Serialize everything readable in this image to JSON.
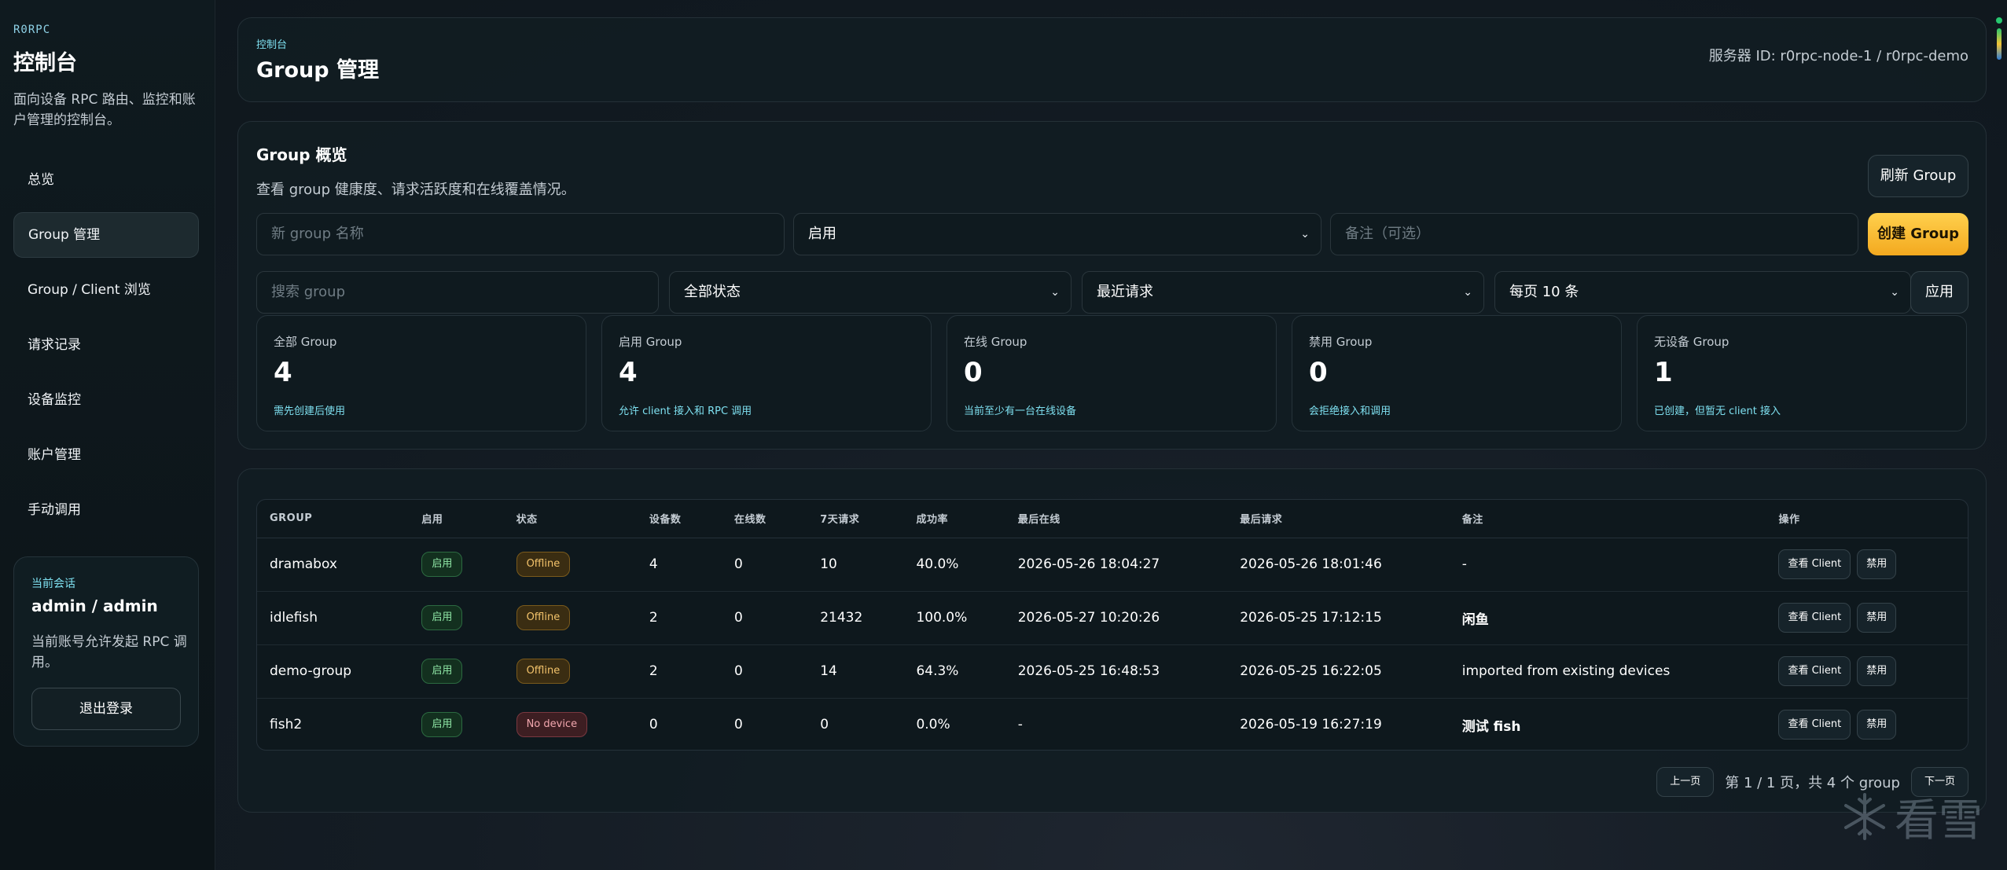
{
  "sidebar": {
    "brand": "R0RPC",
    "title": "控制台",
    "description": "面向设备 RPC 路由、监控和账户管理的控制台。",
    "nav": [
      {
        "label": "总览",
        "active": false
      },
      {
        "label": "Group 管理",
        "active": true
      },
      {
        "label": "Group / Client 浏览",
        "active": false
      },
      {
        "label": "请求记录",
        "active": false
      },
      {
        "label": "设备监控",
        "active": false
      },
      {
        "label": "账户管理",
        "active": false
      },
      {
        "label": "手动调用",
        "active": false
      }
    ],
    "session": {
      "label": "当前会话",
      "user": "admin / admin",
      "description": "当前账号允许发起 RPC 调用。",
      "logout_label": "退出登录"
    }
  },
  "header": {
    "breadcrumb": "控制台",
    "title": "Group 管理",
    "server": "服务器 ID: r0rpc-node-1 / r0rpc-demo"
  },
  "overview": {
    "title": "Group 概览",
    "description": "查看 group 健康度、请求活跃度和在线覆盖情况。",
    "refresh_label": "刷新 Group",
    "create_label": "创建 Group",
    "apply_label": "应用",
    "name_placeholder": "新 group 名称",
    "enable_select": "启用",
    "note_placeholder": "备注（可选）",
    "search_placeholder": "搜索 group",
    "status_select": "全部状态",
    "sort_select": "最近请求",
    "page_size_select": "每页 10 条",
    "stats": [
      {
        "label": "全部 Group",
        "value": "4",
        "note": "需先创建后使用"
      },
      {
        "label": "启用 Group",
        "value": "4",
        "note": "允许 client 接入和 RPC 调用"
      },
      {
        "label": "在线 Group",
        "value": "0",
        "note": "当前至少有一台在线设备"
      },
      {
        "label": "禁用 Group",
        "value": "0",
        "note": "会拒绝接入和调用"
      },
      {
        "label": "无设备 Group",
        "value": "1",
        "note": "已创建，但暂无 client 接入"
      }
    ]
  },
  "table": {
    "columns": [
      "GROUP",
      "启用",
      "状态",
      "设备数",
      "在线数",
      "7天请求",
      "成功率",
      "最后在线",
      "最后请求",
      "备注",
      "操作"
    ],
    "rows": [
      {
        "group": "dramabox",
        "enabled": "启用",
        "status": "Offline",
        "status_kind": "offline",
        "devices": "4",
        "online": "0",
        "requests": "10",
        "success": "40.0%",
        "last_online": "2026-05-26 18:04:27",
        "last_request": "2026-05-26 18:01:46",
        "note": "-",
        "note_bold": false
      },
      {
        "group": "idlefish",
        "enabled": "启用",
        "status": "Offline",
        "status_kind": "offline",
        "devices": "2",
        "online": "0",
        "requests": "21432",
        "success": "100.0%",
        "last_online": "2026-05-27 10:20:26",
        "last_request": "2026-05-25 17:12:15",
        "note": "闲鱼",
        "note_bold": true
      },
      {
        "group": "demo-group",
        "enabled": "启用",
        "status": "Offline",
        "status_kind": "offline",
        "devices": "2",
        "online": "0",
        "requests": "14",
        "success": "64.3%",
        "last_online": "2026-05-25 16:48:53",
        "last_request": "2026-05-25 16:22:05",
        "note": "imported from existing devices",
        "note_bold": false
      },
      {
        "group": "fish2",
        "enabled": "启用",
        "status": "No device",
        "status_kind": "nodevice",
        "devices": "0",
        "online": "0",
        "requests": "0",
        "success": "0.0%",
        "last_online": "-",
        "last_request": "2026-05-19 16:27:19",
        "note": "测试 fish",
        "note_bold": true
      }
    ],
    "view_label": "查看 Client",
    "disable_label": "禁用"
  },
  "pagination": {
    "prev_label": "上一页",
    "info": "第 1 / 1 页，共 4 个 group",
    "next_label": "下一页"
  },
  "watermark": "看雪",
  "colors": {
    "accent": "#f3a91f",
    "cyan": "#7ee0f0",
    "enabled": "#8fe6a6",
    "offline": "#f3c36b",
    "nodevice": "#f2a7ae"
  }
}
